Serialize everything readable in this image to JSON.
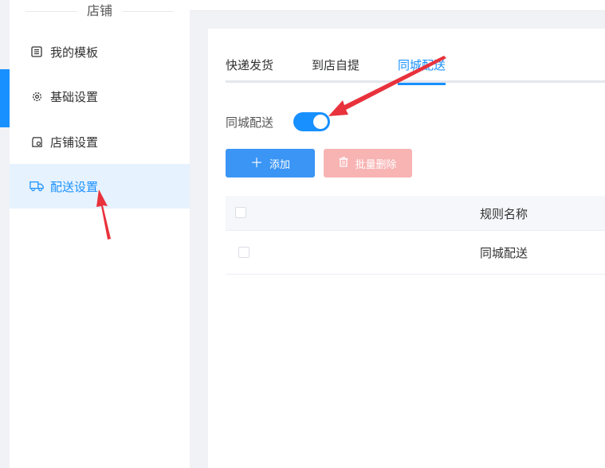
{
  "sidebar": {
    "title": "店铺",
    "items": [
      {
        "label": "我的模板",
        "icon": "list-icon"
      },
      {
        "label": "基础设置",
        "icon": "gear-icon"
      },
      {
        "label": "店铺设置",
        "icon": "store-icon"
      },
      {
        "label": "配送设置",
        "icon": "truck-icon",
        "active": true
      }
    ]
  },
  "tabs": [
    {
      "label": "快递发货"
    },
    {
      "label": "到店自提"
    },
    {
      "label": "同城配送",
      "active": true
    }
  ],
  "switch": {
    "label": "同城配送",
    "on": true
  },
  "buttons": {
    "add": "添加",
    "batch_delete": "批量删除"
  },
  "table": {
    "columns": [
      "规则名称"
    ],
    "rows": [
      [
        "同城配送"
      ]
    ]
  },
  "colors": {
    "accent": "#1890ff",
    "danger_disabled": "#f8b3b3",
    "annotation_arrow": "#e8323c"
  }
}
